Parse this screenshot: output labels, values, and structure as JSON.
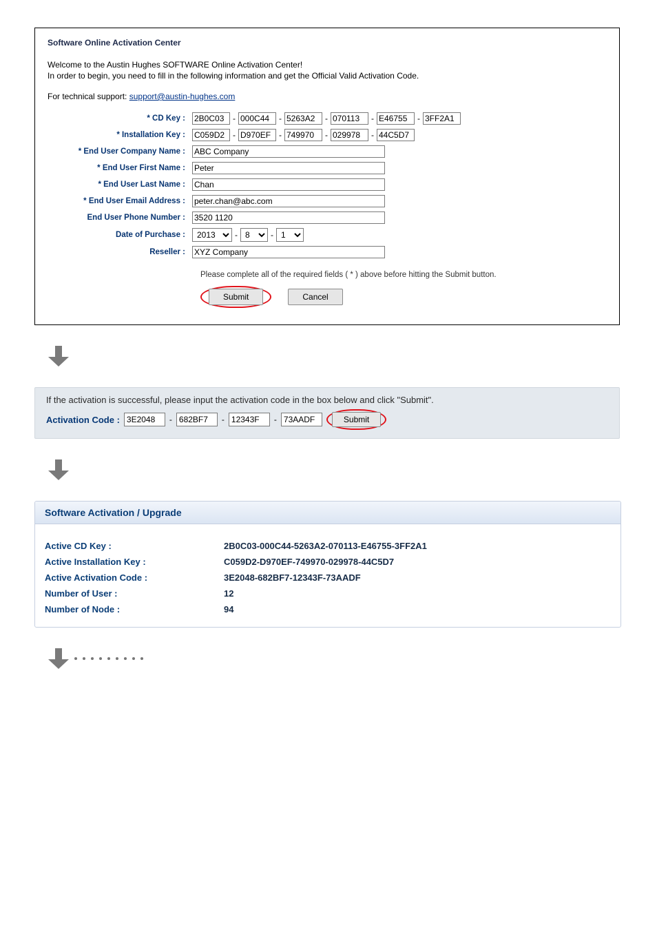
{
  "panel1": {
    "title": "Software Online Activation Center",
    "intro1": "Welcome to the Austin Hughes SOFTWARE Online Activation Center!",
    "intro2": "In order to begin, you need to fill in the following information and get the Official Valid Activation Code.",
    "support_prefix": "For technical support: ",
    "support_link": "support@austin-hughes.com",
    "labels": {
      "cdkey": "* CD Key :",
      "instkey": "* Installation Key :",
      "company": "* End User Company Name :",
      "first": "* End User First Name :",
      "last": "* End User Last Name :",
      "email": "* End User Email Address :",
      "phone": "End User Phone Number :",
      "date": "Date of Purchase :",
      "reseller": "Reseller :"
    },
    "cdkey": [
      "2B0C03",
      "000C44",
      "5263A2",
      "070113",
      "E46755",
      "3FF2A1"
    ],
    "instkey": [
      "C059D2",
      "D970EF",
      "749970",
      "029978",
      "44C5D7"
    ],
    "company": "ABC Company",
    "first": "Peter",
    "last": "Chan",
    "email": "peter.chan@abc.com",
    "phone": "3520 1120",
    "date": {
      "year": "2013",
      "month": "8",
      "day": "1"
    },
    "reseller": "XYZ Company",
    "note": "Please complete all of the required fields ( * ) above before hitting the Submit button.",
    "submit": "Submit",
    "cancel": "Cancel"
  },
  "panel2": {
    "msg": "If the activation is successful, please input the activation code in the box below and click \"Submit\".",
    "label": "Activation Code :",
    "code": [
      "3E2048",
      "682BF7",
      "12343F",
      "73AADF"
    ],
    "submit": "Submit"
  },
  "panel3": {
    "title": "Software Activation / Upgrade",
    "labels": {
      "cd": "Active CD Key :",
      "inst": "Active Installation Key :",
      "act": "Active Activation Code :",
      "user": "Number of User :",
      "node": "Number of Node :"
    },
    "values": {
      "cd": "2B0C03-000C44-5263A2-070113-E46755-3FF2A1",
      "inst": "C059D2-D970EF-749970-029978-44C5D7",
      "act": "3E2048-682BF7-12343F-73AADF",
      "user": "12",
      "node": "94"
    }
  }
}
